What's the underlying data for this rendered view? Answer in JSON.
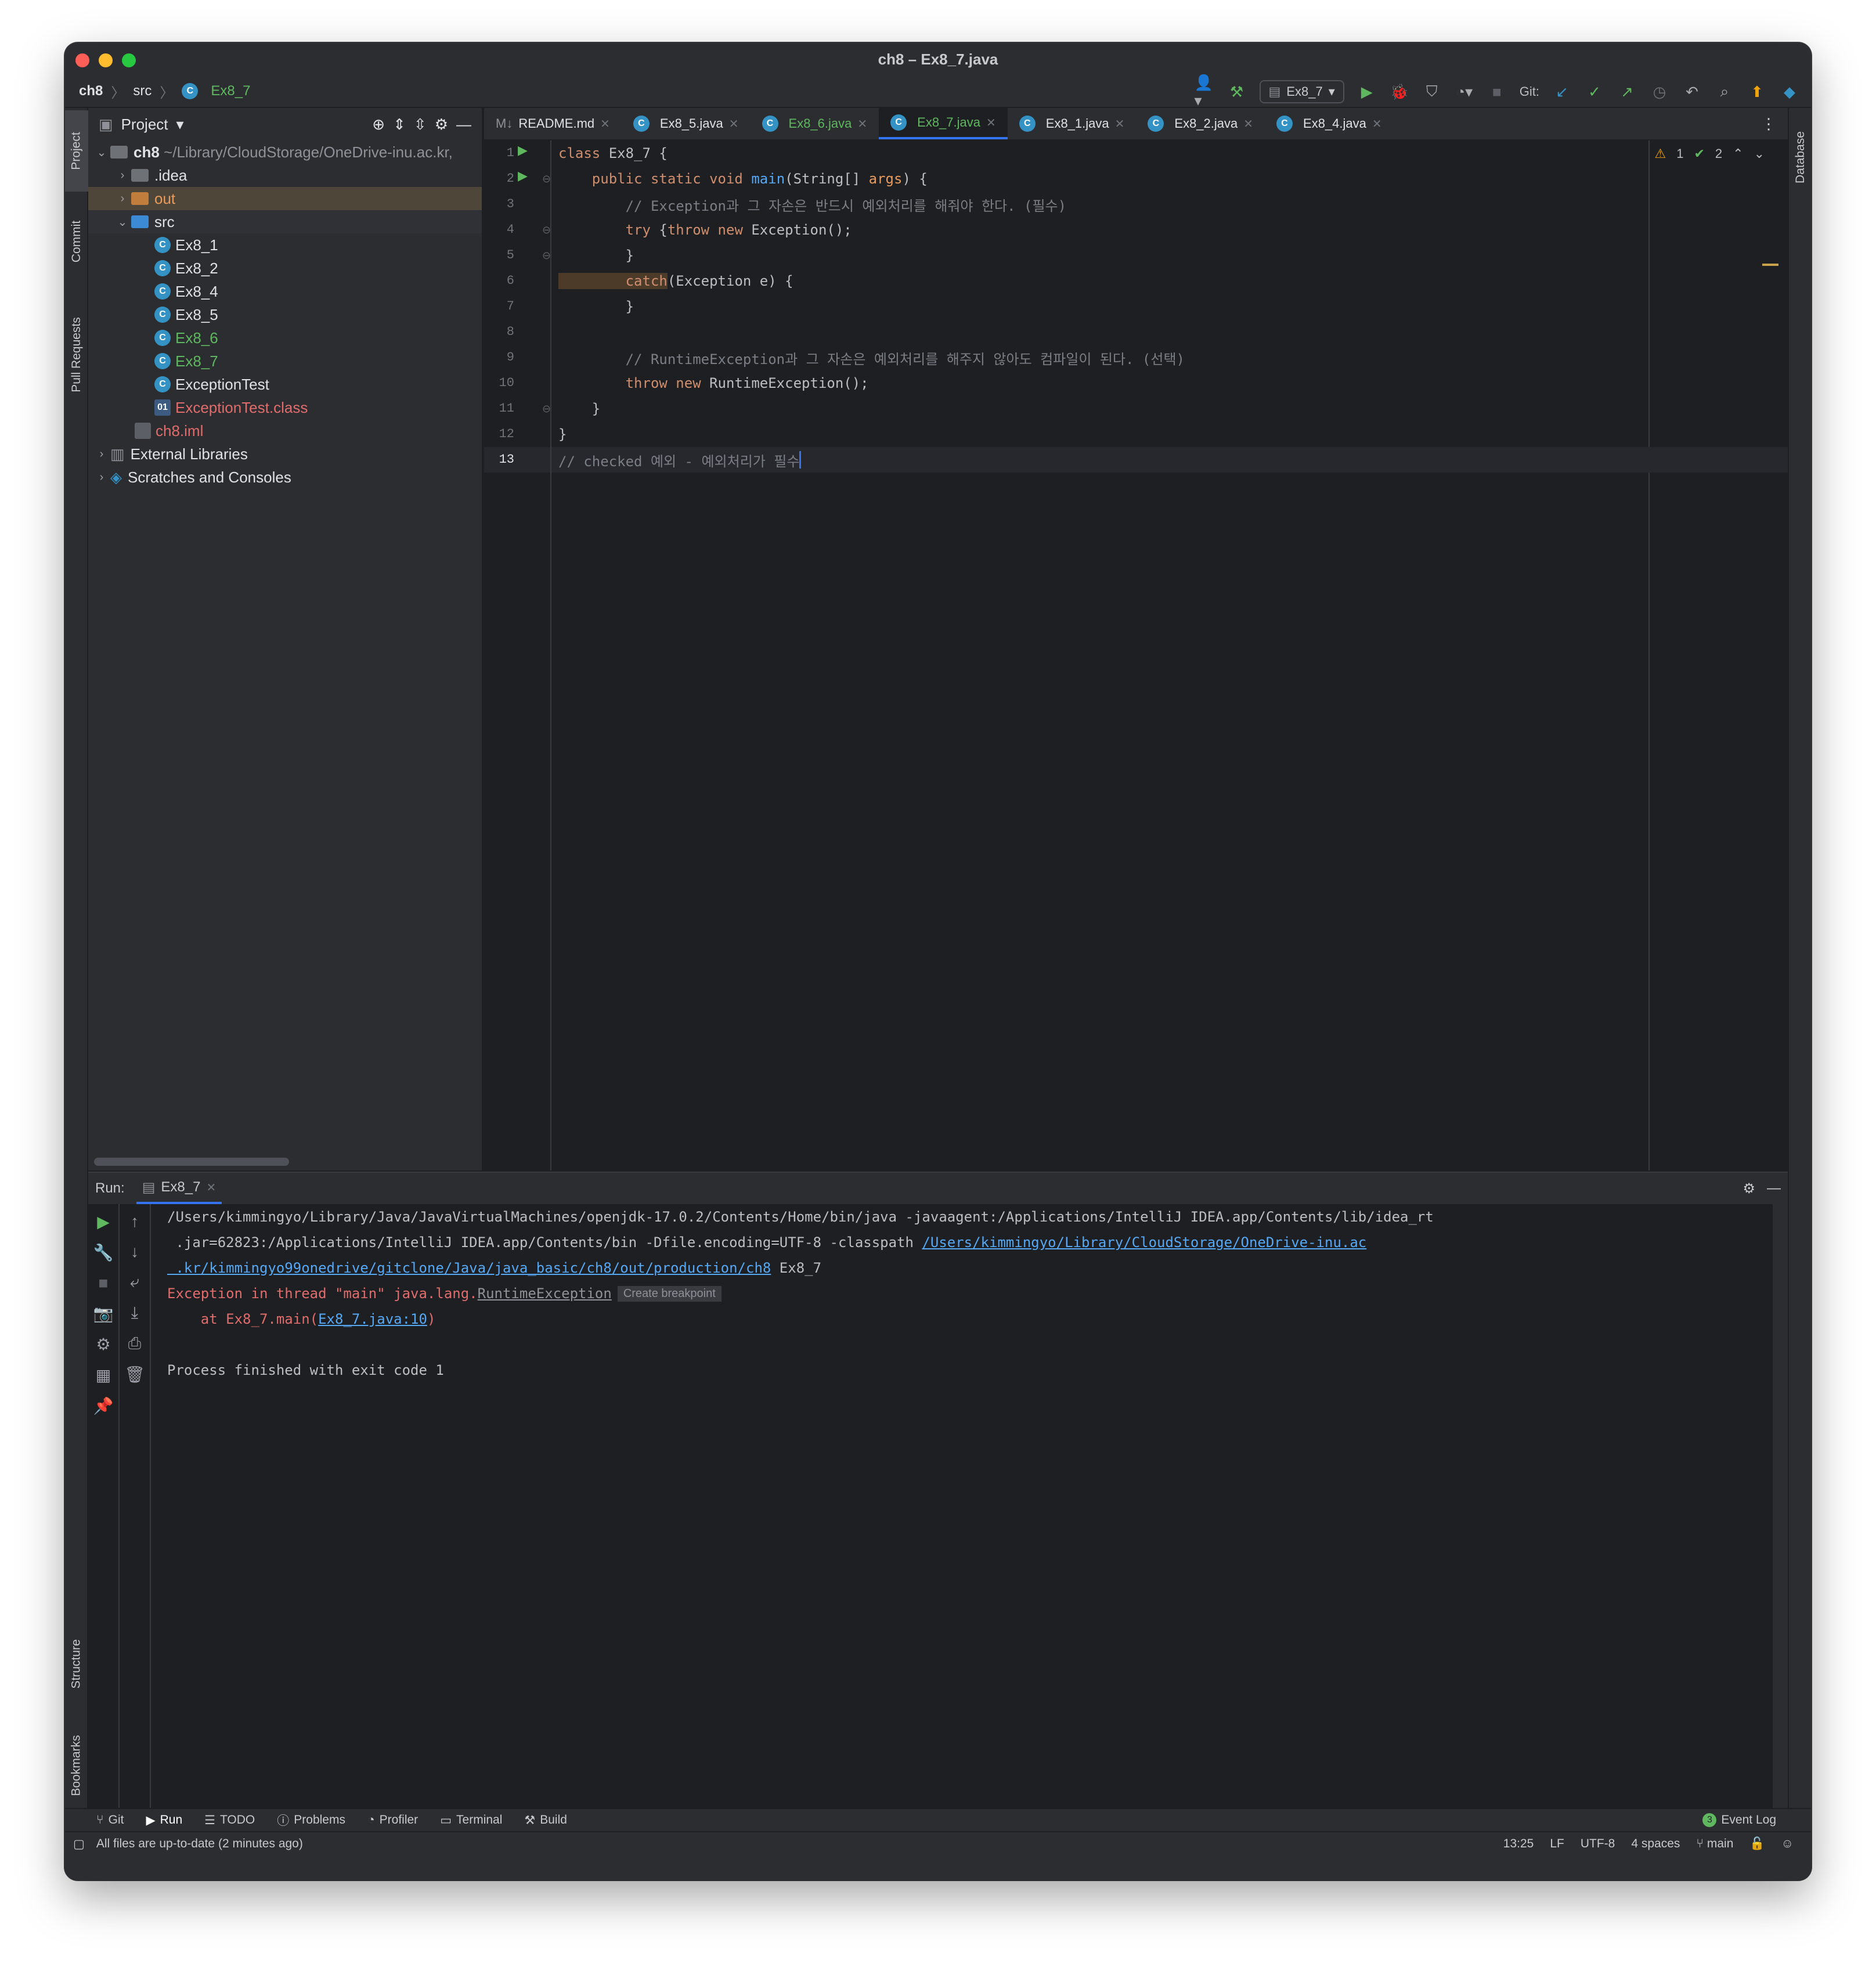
{
  "window": {
    "title": "ch8 – Ex8_7.java"
  },
  "breadcrumb": {
    "project": "ch8",
    "folder": "src",
    "file": "Ex8_7"
  },
  "toolbar": {
    "run_config": "Ex8_7",
    "git_label": "Git:"
  },
  "left_tools": {
    "project": "Project",
    "commit": "Commit",
    "pull_requests": "Pull Requests",
    "structure": "Structure",
    "bookmarks": "Bookmarks"
  },
  "right_tools": {
    "database": "Database"
  },
  "project_panel": {
    "title": "Project",
    "root": {
      "name": "ch8",
      "path": "~/Library/CloudStorage/OneDrive-inu.ac.kr,"
    },
    "items": [
      {
        "label": ".idea",
        "kind": "folder"
      },
      {
        "label": "out",
        "kind": "folder"
      },
      {
        "label": "src",
        "kind": "folder"
      },
      {
        "label": "Ex8_1"
      },
      {
        "label": "Ex8_2"
      },
      {
        "label": "Ex8_4"
      },
      {
        "label": "Ex8_5"
      },
      {
        "label": "Ex8_6"
      },
      {
        "label": "Ex8_7"
      },
      {
        "label": "ExceptionTest"
      },
      {
        "label": "ExceptionTest.class"
      },
      {
        "label": "ch8.iml"
      },
      {
        "label": "External Libraries"
      },
      {
        "label": "Scratches and Consoles"
      }
    ]
  },
  "editor_tabs": [
    "README.md",
    "Ex8_5.java",
    "Ex8_6.java",
    "Ex8_7.java",
    "Ex8_1.java",
    "Ex8_2.java",
    "Ex8_4.java"
  ],
  "inspections": {
    "warnings": "1",
    "checks": "2"
  },
  "code_lines": {
    "l1a": "class",
    "l1b": " Ex8_7 {",
    "l2a": "    public static void",
    "l2b": " main",
    "l2c": "(String[] ",
    "l2d": "args",
    "l2e": ") {",
    "l3": "        // Exception과 그 자손은 반드시 예외처리를 해줘야 한다. (필수)",
    "l4a": "        try",
    "l4b": " {",
    "l4c": "throw new",
    "l4d": " Exception();",
    "l5": "        }",
    "l6a": "        catch",
    "l6b": "(Exception e) {",
    "l7": "        }",
    "l8": "",
    "l9": "        // RuntimeException과 그 자손은 예외처리를 해주지 않아도 컴파일이 된다. (선택)",
    "l10a": "        throw new",
    "l10b": " RuntimeException();",
    "l11": "    }",
    "l12": "}",
    "l13": "// checked 예외 - 예외처리가 필수"
  },
  "line_numbers": [
    "1",
    "2",
    "3",
    "4",
    "5",
    "6",
    "7",
    "8",
    "9",
    "10",
    "11",
    "12",
    "13"
  ],
  "run_panel": {
    "label": "Run:",
    "tab": "Ex8_7",
    "console": {
      "line1": "/Users/kimmingyo/Library/Java/JavaVirtualMachines/openjdk-17.0.2/Contents/Home/bin/java -javaagent:/Applications/IntelliJ IDEA.app/Contents/lib/idea_rt",
      "line2a": " .jar=62823:/Applications/IntelliJ IDEA.app/Contents/bin -Dfile.encoding=UTF-8 -classpath ",
      "line2b": "/Users/kimmingyo/Library/CloudStorage/OneDrive-inu.ac",
      "line3a": " .kr/kimmingyo99onedrive/gitclone/Java/java_basic/ch8/out/production/ch8",
      "line3b": " Ex8_7",
      "line4a": "Exception in thread \"main\" java.lang.",
      "line4b": "RuntimeException",
      "line4c": "Create breakpoint",
      "line5a": "    at Ex8_7.main(",
      "line5b": "Ex8_7.java:10",
      "line5c": ")",
      "line7": "Process finished with exit code 1"
    }
  },
  "bottom_tools": [
    "Git",
    "Run",
    "TODO",
    "Problems",
    "Profiler",
    "Terminal",
    "Build"
  ],
  "event_log": {
    "count": "3",
    "label": "Event Log"
  },
  "status": {
    "message": "All files are up-to-date (2 minutes ago)",
    "position": "13:25",
    "line_sep": "LF",
    "encoding": "UTF-8",
    "indent": "4 spaces",
    "branch": "main"
  }
}
